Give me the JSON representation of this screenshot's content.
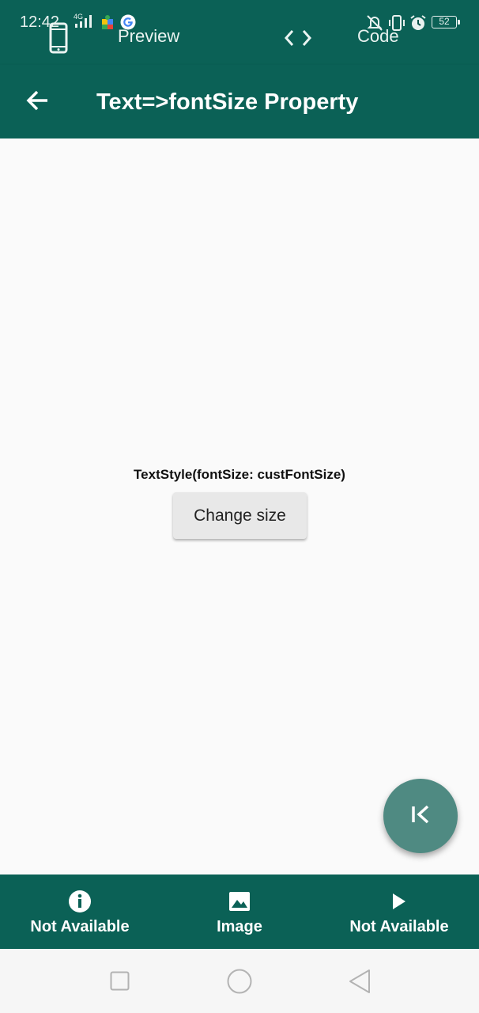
{
  "status_bar": {
    "time": "12:42",
    "network": "4G",
    "battery": "52",
    "icons": [
      "signal-icon",
      "puzzle-icon",
      "google-icon",
      "vibrate-off-icon",
      "vibrate-icon",
      "alarm-icon",
      "battery-icon"
    ]
  },
  "top_tabs": {
    "preview_label": "Preview",
    "code_label": "Code",
    "icons": [
      "phone-icon",
      "code-brackets-icon"
    ]
  },
  "app_bar": {
    "title": "Text=>fontSize Property",
    "back_icon": "arrow-left-icon"
  },
  "main": {
    "demo_text": "TextStyle(fontSize: custFontSize)",
    "button_label": "Change size",
    "fab_icon": "first-page-icon"
  },
  "bottom_nav": {
    "items": [
      {
        "label": "Not Available",
        "icon": "info-icon"
      },
      {
        "label": "Image",
        "icon": "image-icon"
      },
      {
        "label": "Not Available",
        "icon": "play-icon"
      }
    ]
  },
  "system_nav": {
    "icons": [
      "recents-square-icon",
      "home-circle-icon",
      "back-triangle-icon"
    ]
  },
  "colors": {
    "primary": "#0b6156",
    "status_bar": "#075048",
    "fab": "#4f8a82",
    "background": "#fafafa",
    "button": "#e8e8e8"
  }
}
